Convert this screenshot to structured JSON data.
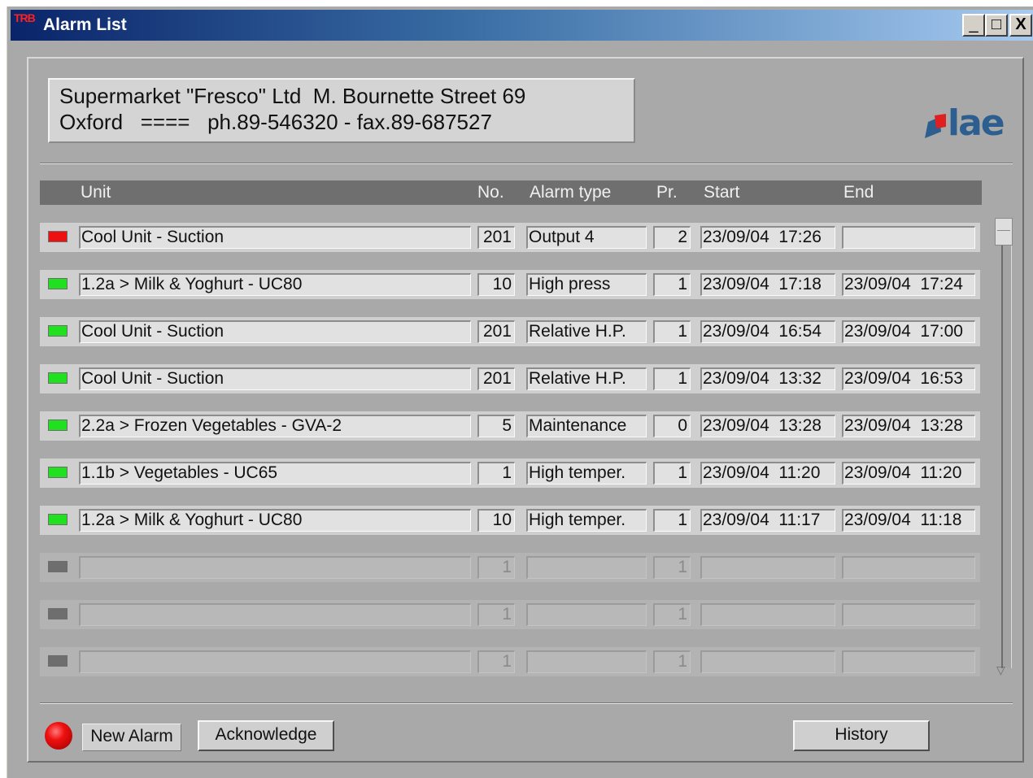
{
  "window": {
    "title": "Alarm List",
    "app_icon_text": "TRB",
    "minimize": "_",
    "maximize": "□",
    "close": "X"
  },
  "header": {
    "line1": "Supermarket \"Fresco\" Ltd  M. Bournette Street 69",
    "line2": "Oxford   ====   ph.89-546320 - fax.89-687527"
  },
  "logo": {
    "text": "lae",
    "color": "#2c5e8f"
  },
  "columns": {
    "unit": "Unit",
    "no": "No.",
    "type": "Alarm type",
    "pr": "Pr.",
    "start": "Start",
    "end": "End"
  },
  "status_colors": {
    "active": "#ee1111",
    "ended": "#20e020",
    "empty": "#6e6e6e"
  },
  "rows": [
    {
      "status": "active",
      "unit": "Cool Unit - Suction",
      "no": "201",
      "type": "Output 4",
      "pr": "2",
      "start": "23/09/04  17:26",
      "end": ""
    },
    {
      "status": "ended",
      "unit": "1.2a > Milk & Yoghurt - UC80",
      "no": "10",
      "type": "High press",
      "pr": "1",
      "start": "23/09/04  17:18",
      "end": "23/09/04  17:24"
    },
    {
      "status": "ended",
      "unit": "Cool Unit - Suction",
      "no": "201",
      "type": "Relative H.P.",
      "pr": "1",
      "start": "23/09/04  16:54",
      "end": "23/09/04  17:00"
    },
    {
      "status": "ended",
      "unit": "Cool Unit - Suction",
      "no": "201",
      "type": "Relative H.P.",
      "pr": "1",
      "start": "23/09/04  13:32",
      "end": "23/09/04  16:53"
    },
    {
      "status": "ended",
      "unit": "2.2a > Frozen Vegetables - GVA-2",
      "no": "5",
      "type": "Maintenance",
      "pr": "0",
      "start": "23/09/04  13:28",
      "end": "23/09/04  13:28"
    },
    {
      "status": "ended",
      "unit": "1.1b > Vegetables - UC65",
      "no": "1",
      "type": "High temper.",
      "pr": "1",
      "start": "23/09/04  11:20",
      "end": "23/09/04  11:20"
    },
    {
      "status": "ended",
      "unit": "1.2a > Milk & Yoghurt - UC80",
      "no": "10",
      "type": "High temper.",
      "pr": "1",
      "start": "23/09/04  11:17",
      "end": "23/09/04  11:18"
    },
    {
      "status": "empty",
      "unit": "",
      "no": "1",
      "type": "",
      "pr": "1",
      "start": "",
      "end": ""
    },
    {
      "status": "empty",
      "unit": "",
      "no": "1",
      "type": "",
      "pr": "1",
      "start": "",
      "end": ""
    },
    {
      "status": "empty",
      "unit": "",
      "no": "1",
      "type": "",
      "pr": "1",
      "start": "",
      "end": ""
    }
  ],
  "footer": {
    "new_alarm": "New Alarm",
    "acknowledge": "Acknowledge",
    "history": "History",
    "alarm_lamp_color": "#f01010"
  }
}
